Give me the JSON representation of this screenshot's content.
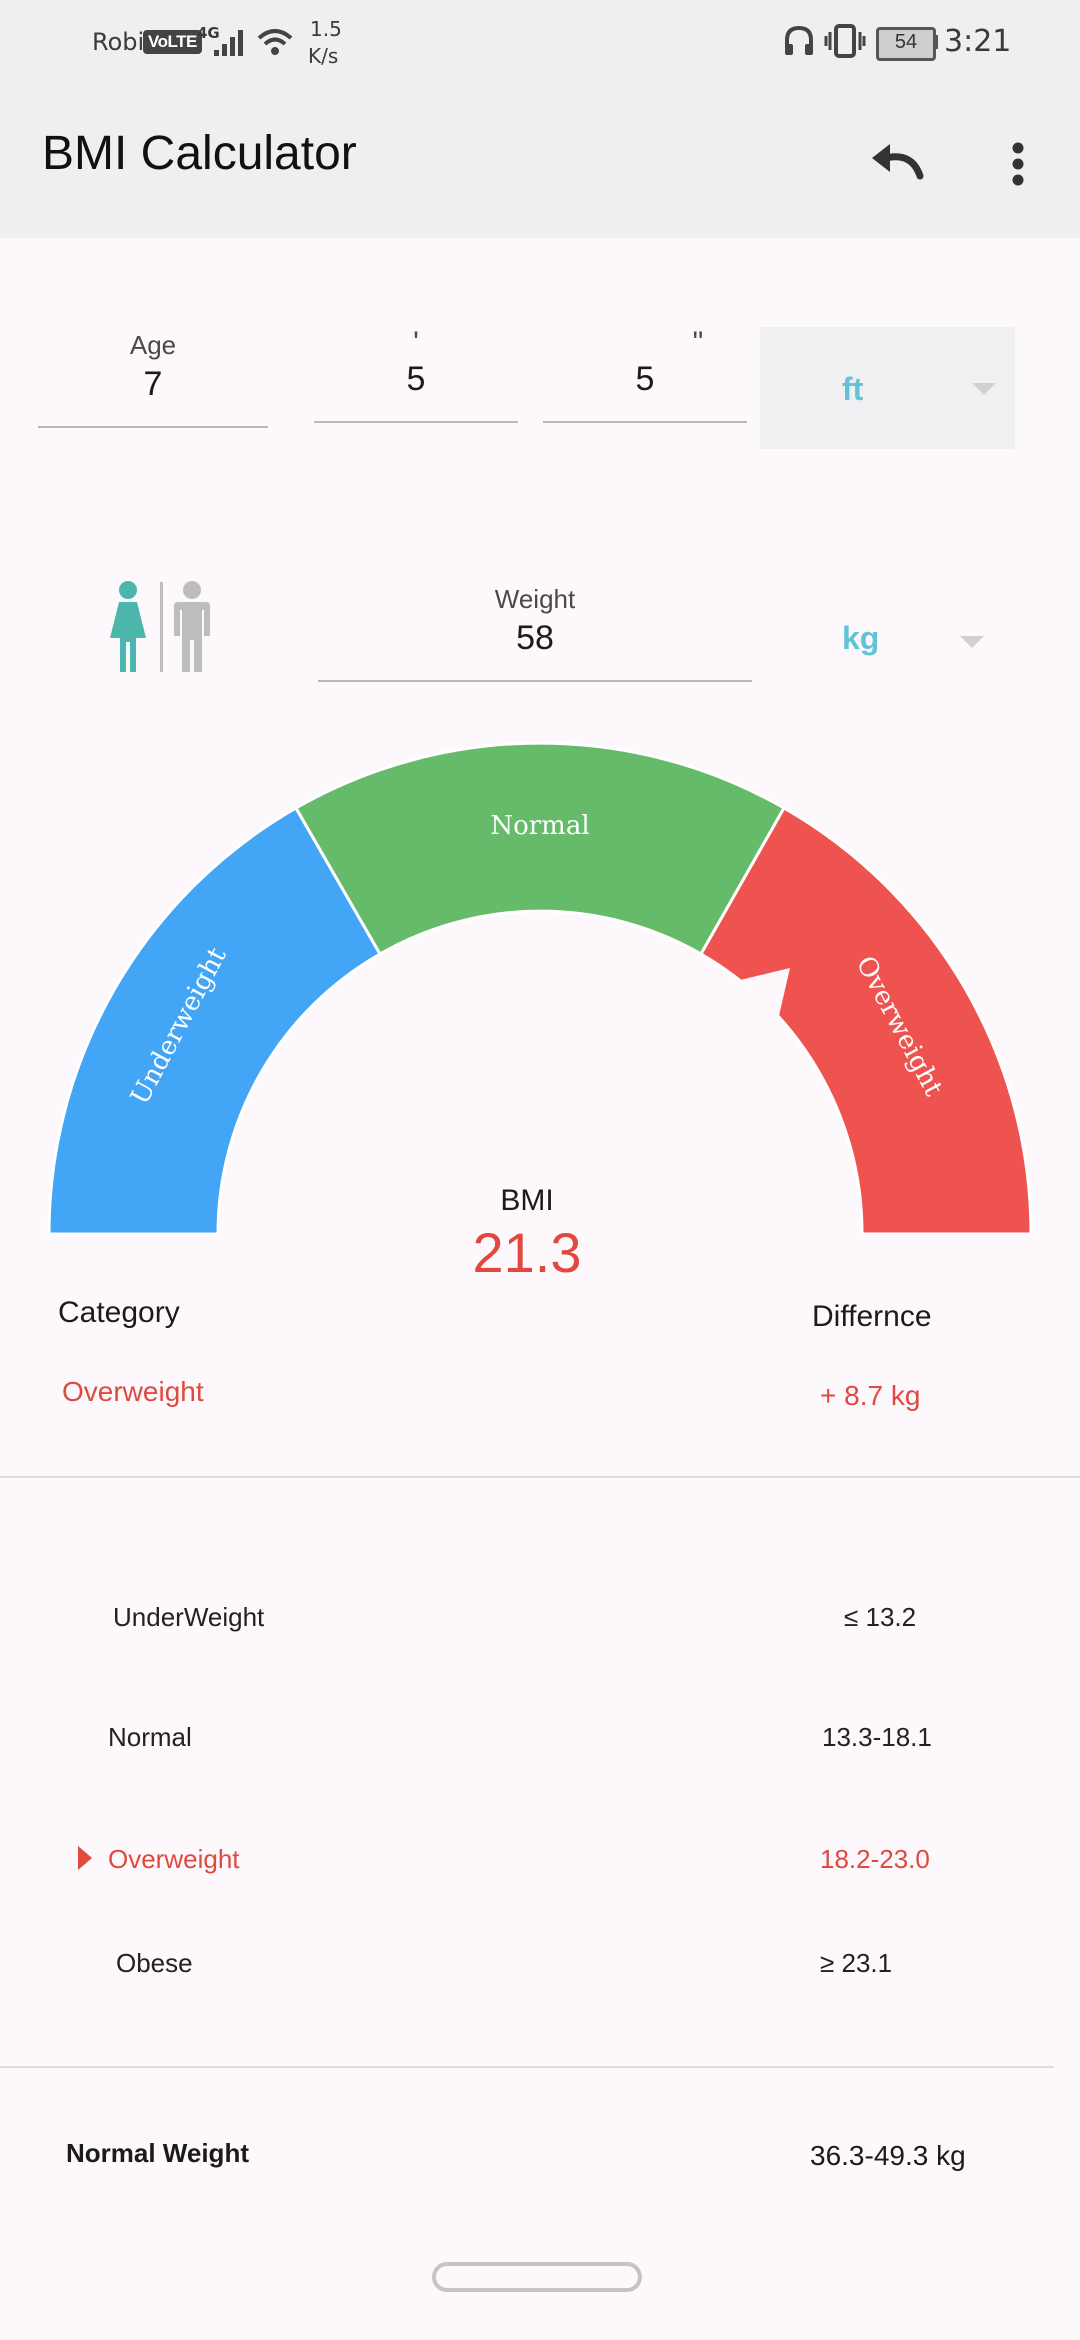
{
  "status_bar": {
    "carrier": "Robi",
    "volte": "VoLTE",
    "network": "4G",
    "speed_value": "1.5",
    "speed_unit": "K/s",
    "battery": "54",
    "time": "3:21"
  },
  "app_bar": {
    "title": "BMI Calculator",
    "icons": [
      "undo-icon",
      "more-vert-icon"
    ]
  },
  "inputs": {
    "age_label": "Age",
    "age_value": "7",
    "feet_symbol": "'",
    "feet_value": "5",
    "inches_symbol": "\"",
    "inches_value": "5",
    "height_unit": "ft",
    "weight_label": "Weight",
    "weight_value": "58",
    "weight_unit": "kg",
    "gender_icons": [
      "female-icon",
      "male-icon"
    ]
  },
  "gauge": {
    "segments": [
      {
        "label": "Underweight",
        "color": "#42a5f5"
      },
      {
        "label": "Normal",
        "color": "#66bb6a"
      },
      {
        "label": "Overweight",
        "color": "#ef5350"
      }
    ],
    "bmi_label": "BMI",
    "bmi_value": "21.3"
  },
  "result": {
    "category_label": "Category",
    "category_value": "Overweight",
    "difference_label": "Differnce",
    "difference_value": "+ 8.7 kg"
  },
  "ranges": [
    {
      "label": "UnderWeight",
      "value": "≤ 13.2",
      "selected": false
    },
    {
      "label": "Normal",
      "value": "13.3-18.1",
      "selected": false
    },
    {
      "label": "Overweight",
      "value": "18.2-23.0",
      "selected": true
    },
    {
      "label": "Obese",
      "value": "≥ 23.1",
      "selected": false
    }
  ],
  "normal_weight": {
    "label": "Normal Weight",
    "value": "36.3-49.3 kg"
  },
  "colors": {
    "accent_text": "#e0493f",
    "dropdown_text": "#5fc4d8",
    "female_active": "#4db6ac",
    "male_inactive": "#bdbdbd"
  }
}
